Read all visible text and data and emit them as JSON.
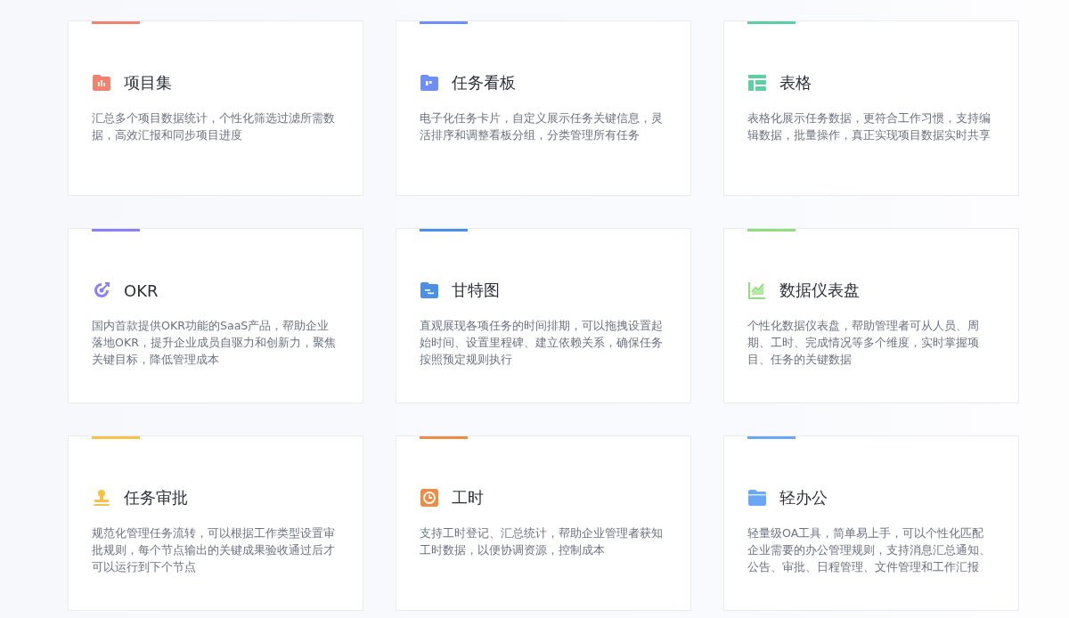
{
  "features": [
    {
      "kind": "folder-chart",
      "color": "#f0826f",
      "title": "项目集",
      "description": "汇总多个项目数据统计，个性化筛选过滤所需数据，高效汇报和同步项目进度"
    },
    {
      "kind": "folder-board",
      "color": "#6d8ff7",
      "title": "任务看板",
      "description": "电子化任务卡片，自定义展示任务关键信息，灵活排序和调整看板分组，分类管理所有任务"
    },
    {
      "kind": "table",
      "color": "#5dcfa2",
      "title": "表格",
      "description": "表格化展示任务数据，更符合工作习惯，支持编辑数据，批量操作，真正实现项目数据实时共享"
    },
    {
      "kind": "target",
      "color": "#8a82f4",
      "title": "OKR",
      "description": "国内首款提供OKR功能的SaaS产品，帮助企业落地OKR，提升企业成员自驱力和创新力，聚焦关键目标，降低管理成本"
    },
    {
      "kind": "folder-gantt",
      "color": "#4b8fe6",
      "title": "甘特图",
      "description": "直观展现各项任务的时间排期，可以拖拽设置起始时间、设置里程碑、建立依赖关系，确保任务按照预定规则执行"
    },
    {
      "kind": "line-chart",
      "color": "#8fe07b",
      "title": "数据仪表盘",
      "description": "个性化数据仪表盘，帮助管理者可从人员、周期、工时、完成情况等多个维度，实时掌握项目、任务的关键数据"
    },
    {
      "kind": "stamp",
      "color": "#f7c245",
      "title": "任务审批",
      "description": "规范化管理任务流转，可以根据工作类型设置审批规则，每个节点输出的关键成果验收通过后才可以运行到下个节点"
    },
    {
      "kind": "clock",
      "color": "#f08b45",
      "title": "工时",
      "description": "支持工时登记、汇总统计，帮助企业管理者获知工时数据，以便协调资源，控制成本"
    },
    {
      "kind": "folder",
      "color": "#6aa8f5",
      "title": "轻办公",
      "description": "轻量级OA工具，简单易上手，可以个性化匹配企业需要的办公管理规则，支持消息汇总通知、公告、审批、日程管理、文件管理和工作汇报"
    }
  ]
}
